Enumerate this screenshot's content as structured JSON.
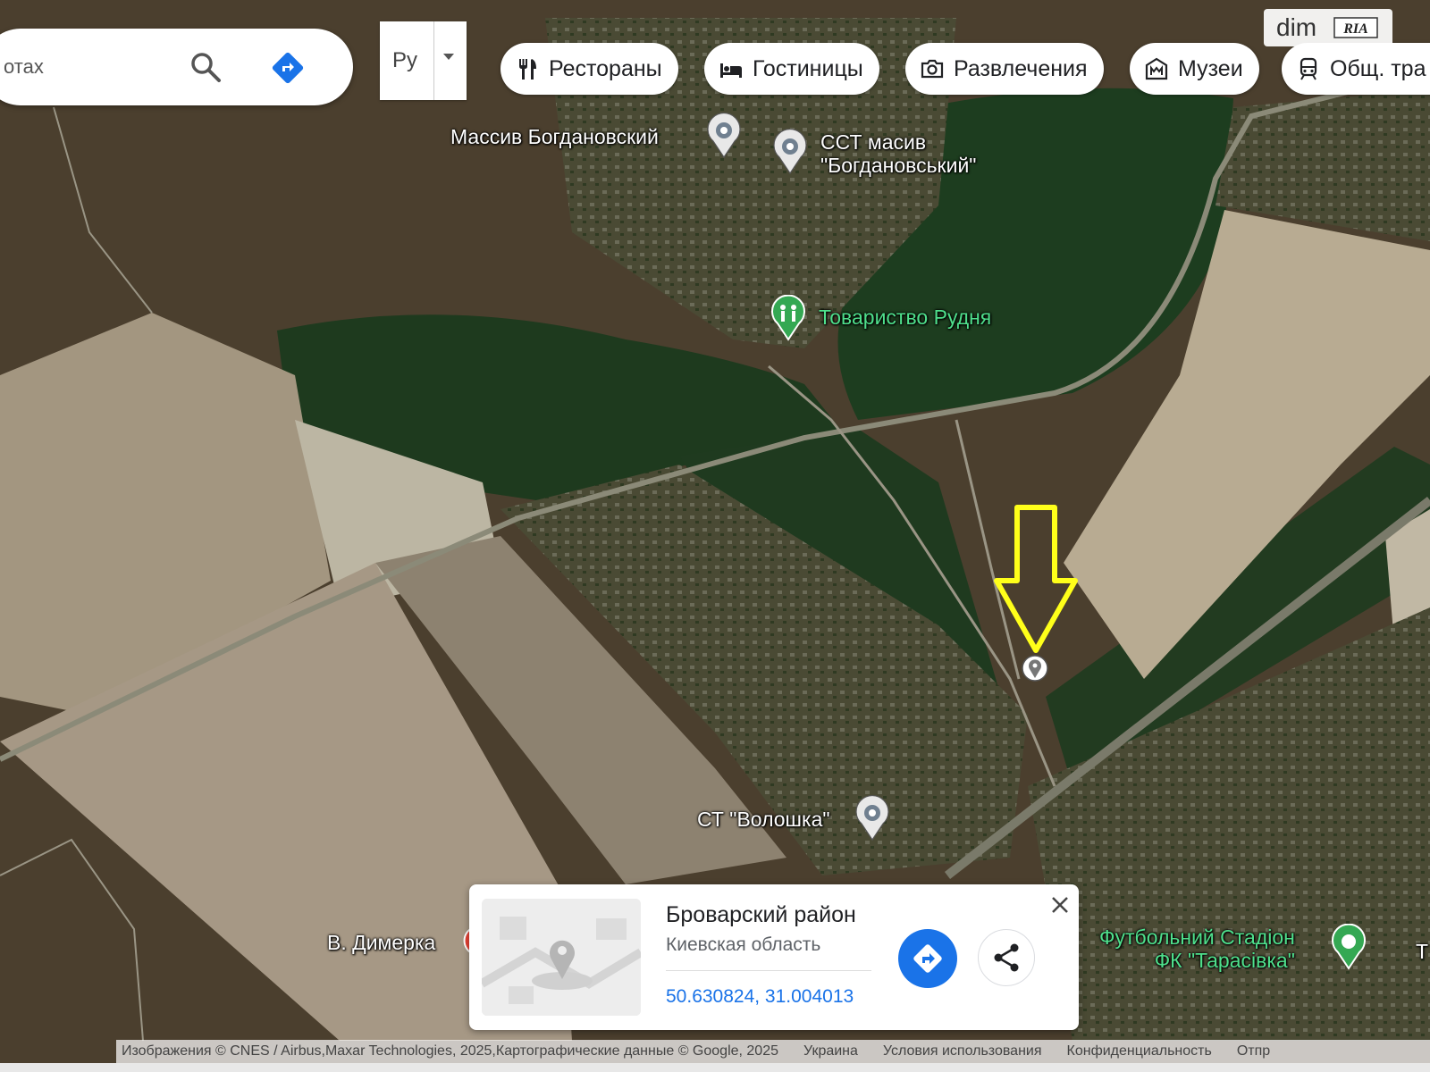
{
  "search": {
    "text": "отах"
  },
  "language": {
    "label": "Ру"
  },
  "chips": [
    {
      "id": "restaurants",
      "label": "Рестораны",
      "icon": "fork-knife-icon"
    },
    {
      "id": "hotels",
      "label": "Гостиницы",
      "icon": "bed-icon"
    },
    {
      "id": "entertainment",
      "label": "Развлечения",
      "icon": "camera-icon"
    },
    {
      "id": "museums",
      "label": "Музеи",
      "icon": "museum-icon"
    },
    {
      "id": "transit",
      "label": "Общ. тра",
      "icon": "train-icon"
    }
  ],
  "logo": {
    "text": "dim",
    "brand": "RIA"
  },
  "places": {
    "bogdanovsky": "Массив Богдановский",
    "sst": "ССТ масив\n\"Богдановський\"",
    "rudnya": "Товариство Рудня",
    "voloshka": "СТ \"Волошка\"",
    "dymerka": "В. Димерка",
    "stadium": "Футбольний Стадіон\nФК \"Тарасівка\"",
    "edge_letter": "Т"
  },
  "card": {
    "title": "Броварский район",
    "subtitle": "Киевская область",
    "coords": "50.630824, 31.004013"
  },
  "attribution": {
    "imagery": "Изображения © CNES / Airbus,Maxar Technologies, 2025,Картографические данные © Google, 2025",
    "country": "Украина",
    "terms": "Условия использования",
    "privacy": "Конфиденциальность",
    "feedback": "Отпр"
  },
  "colors": {
    "accent": "#1a73e8",
    "arrow": "#ffff1a",
    "green_poi": "#34a853"
  }
}
